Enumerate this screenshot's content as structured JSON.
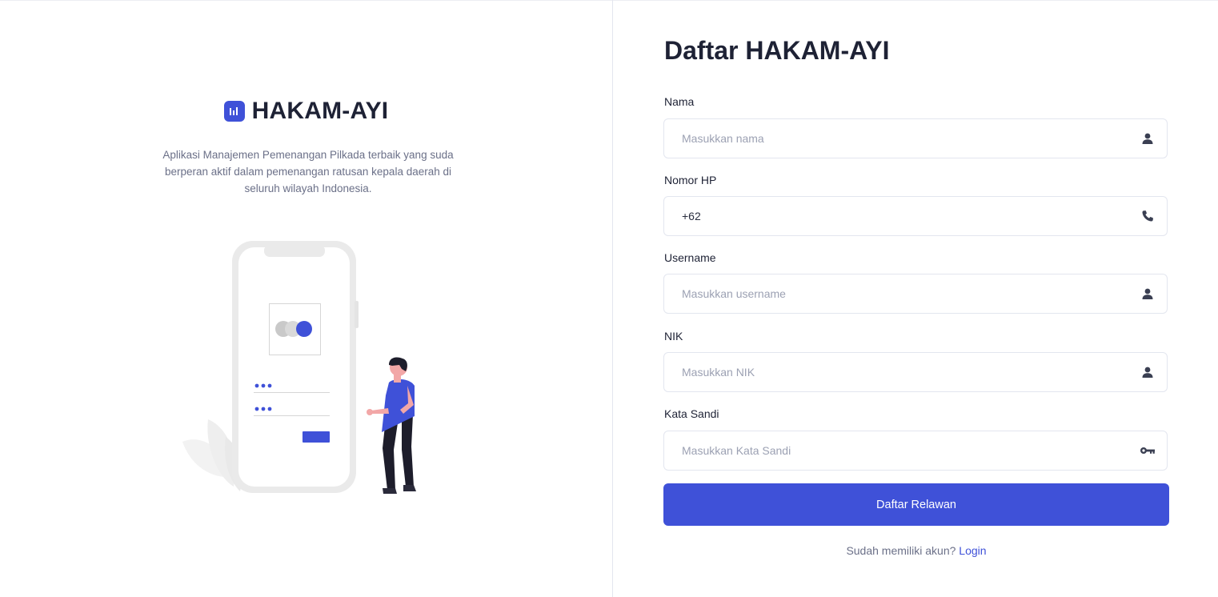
{
  "brand": {
    "name": "HAKAM-AYI",
    "tagline": "Aplikasi Manajemen Pemenangan Pilkada terbaik yang suda berperan aktif dalam pemenangan ratusan kepala daerah di seluruh wilayah Indonesia.",
    "logo_icon": "bar-chart-icon",
    "accent_color": "#3f51d8"
  },
  "illustration": {
    "description_icon": "phone-login-illustration",
    "password_dots": "•••"
  },
  "form": {
    "title": "Daftar HAKAM-AYI",
    "fields": [
      {
        "label": "Nama",
        "value": "",
        "placeholder": "Masukkan nama",
        "icon": "user-icon"
      },
      {
        "label": "Nomor HP",
        "value": "+62",
        "placeholder": "",
        "icon": "phone-icon"
      },
      {
        "label": "Username",
        "value": "",
        "placeholder": "Masukkan username",
        "icon": "user-icon"
      },
      {
        "label": "NIK",
        "value": "",
        "placeholder": "Masukkan NIK",
        "icon": "user-icon"
      },
      {
        "label": "Kata Sandi",
        "value": "",
        "placeholder": "Masukkan Kata Sandi",
        "icon": "key-icon"
      }
    ],
    "submit_label": "Daftar Relawan",
    "login_prompt": "Sudah memiliki akun?",
    "login_link": "Login"
  }
}
